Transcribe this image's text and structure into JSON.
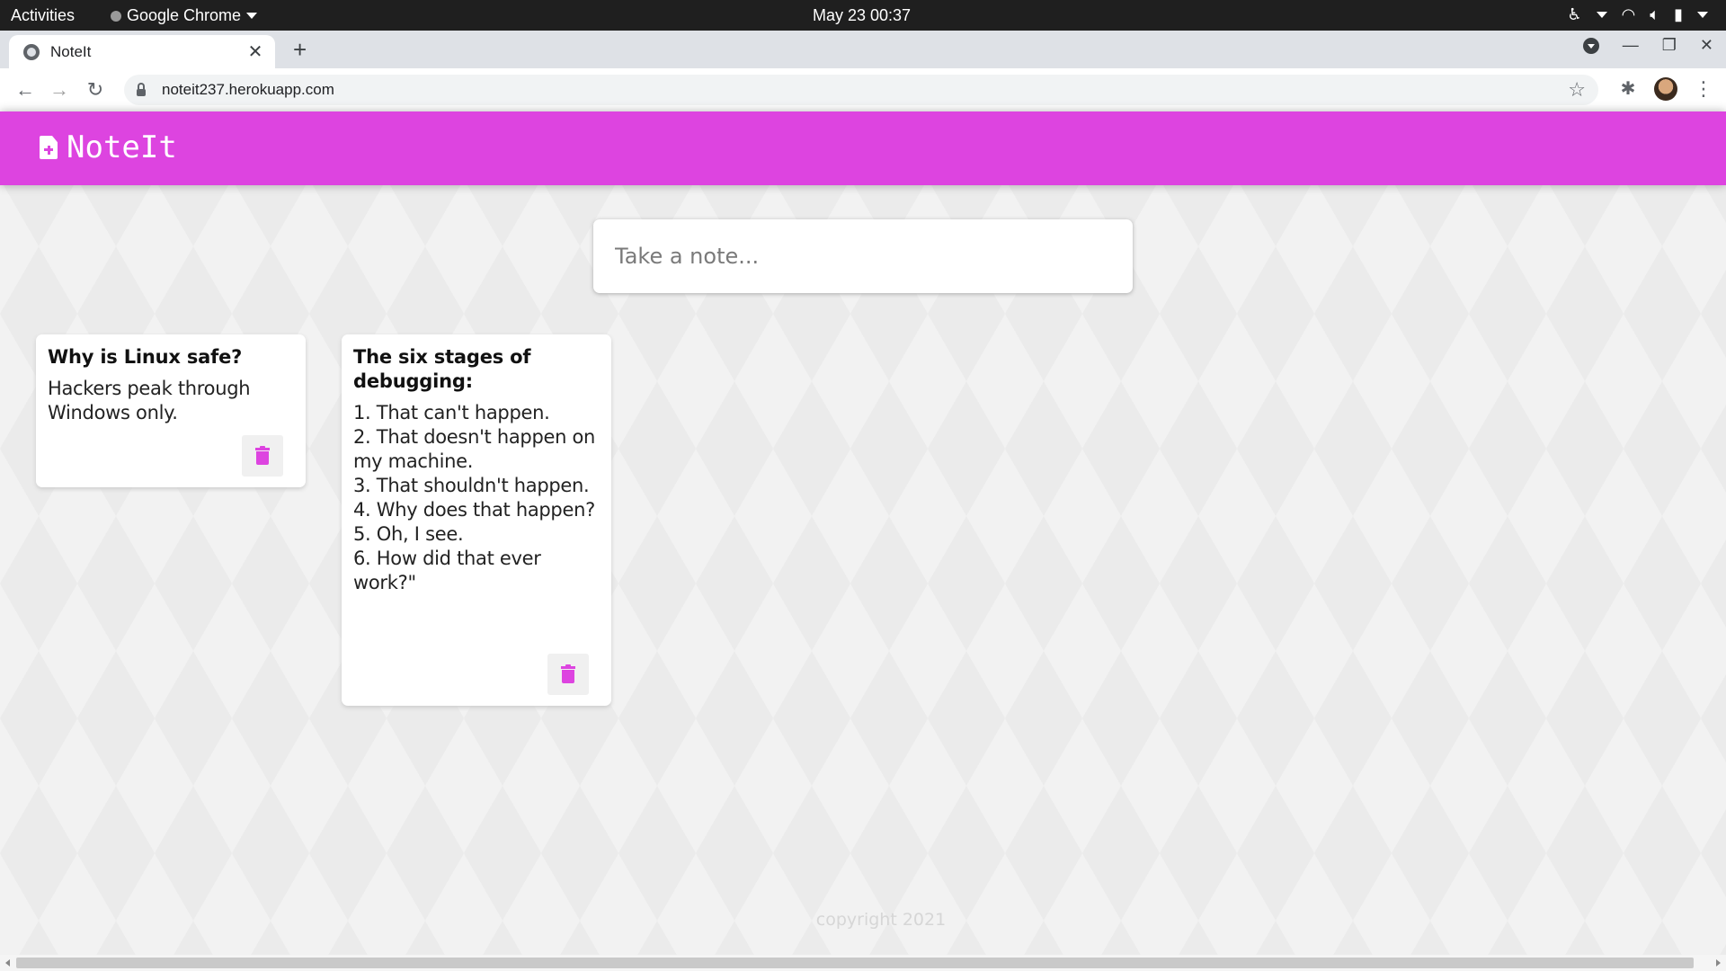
{
  "os": {
    "activities": "Activities",
    "app_name": "Google Chrome",
    "clock": "May 23  00:37"
  },
  "browser": {
    "tab_title": "NoteIt",
    "tab_close": "✕",
    "new_tab": "+",
    "url": "noteit237.herokuapp.com"
  },
  "app": {
    "title": "NoteIt",
    "input_placeholder": "Take a note...",
    "footer": "copyright 2021",
    "accent": "#dd44e0"
  },
  "notes": [
    {
      "title": "Why is Linux safe?",
      "content": "Hackers peak through Windows only."
    },
    {
      "title": "The six stages of debugging:",
      "content": "1. That can't happen.\n2. That doesn't happen on my machine.\n3. That shouldn't happen.\n4. Why does that happen?\n5. Oh, I see.\n6. How did that ever work?\""
    }
  ],
  "icons": {
    "brand": "note-add-icon",
    "delete": "trash-icon"
  }
}
